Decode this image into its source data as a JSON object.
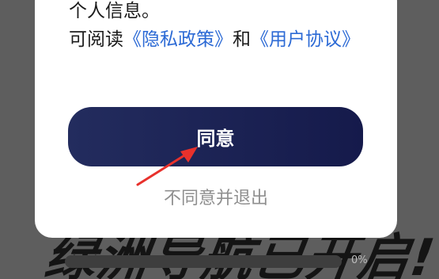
{
  "background": {
    "banner_text": "绿洲导航已开启!",
    "progress_label": "0%",
    "progress_fraction": 0
  },
  "dialog": {
    "line1": "个人信息。",
    "read_prefix": "可阅读",
    "privacy_link": "《隐私政策》",
    "and_text": "和",
    "terms_link": "《用户协议》",
    "agree_label": "同意",
    "disagree_label": "不同意并退出"
  },
  "colors": {
    "link": "#2c6ad5",
    "button_start": "#232c5e",
    "button_end": "#151a4b",
    "arrow": "#e8312c"
  },
  "annotation": {
    "arrow_icon": "red-arrow-pointing-to-agree-button"
  }
}
